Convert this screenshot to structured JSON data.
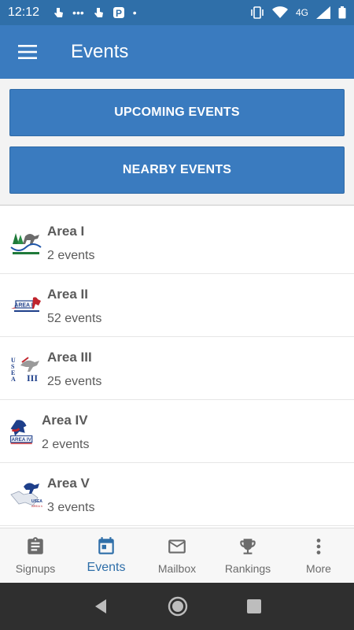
{
  "status_bar": {
    "time": "12:12",
    "network": "4G",
    "colors": {
      "background": "#2f6fa9"
    }
  },
  "app_bar": {
    "title": "Events",
    "menu_icon": "hamburger-menu-icon",
    "colors": {
      "background": "#3a7bbf"
    }
  },
  "actions": {
    "upcoming_label": "UPCOMING EVENTS",
    "nearby_label": "NEARBY EVENTS"
  },
  "areas": [
    {
      "name": "Area I",
      "count": "2 events",
      "logo": "area-1-usea-logo"
    },
    {
      "name": "Area II",
      "count": "52 events",
      "logo": "area-2-logo"
    },
    {
      "name": "Area III",
      "count": "25 events",
      "logo": "area-3-usea-logo"
    },
    {
      "name": "Area IV",
      "count": "2 events",
      "logo": "area-4-logo"
    },
    {
      "name": "Area V",
      "count": "3 events",
      "logo": "area-5-usea-logo"
    }
  ],
  "bottom_nav": {
    "items": [
      {
        "label": "Signups",
        "icon": "clipboard-icon"
      },
      {
        "label": "Events",
        "icon": "calendar-icon"
      },
      {
        "label": "Mailbox",
        "icon": "mail-icon"
      },
      {
        "label": "Rankings",
        "icon": "trophy-icon"
      },
      {
        "label": "More",
        "icon": "more-vert-icon"
      }
    ],
    "active": "Events",
    "colors": {
      "active": "#2f6fa9",
      "inactive": "#6b6b6b"
    }
  },
  "system_nav": {
    "icons": [
      "back-icon",
      "home-icon",
      "recents-icon"
    ]
  }
}
